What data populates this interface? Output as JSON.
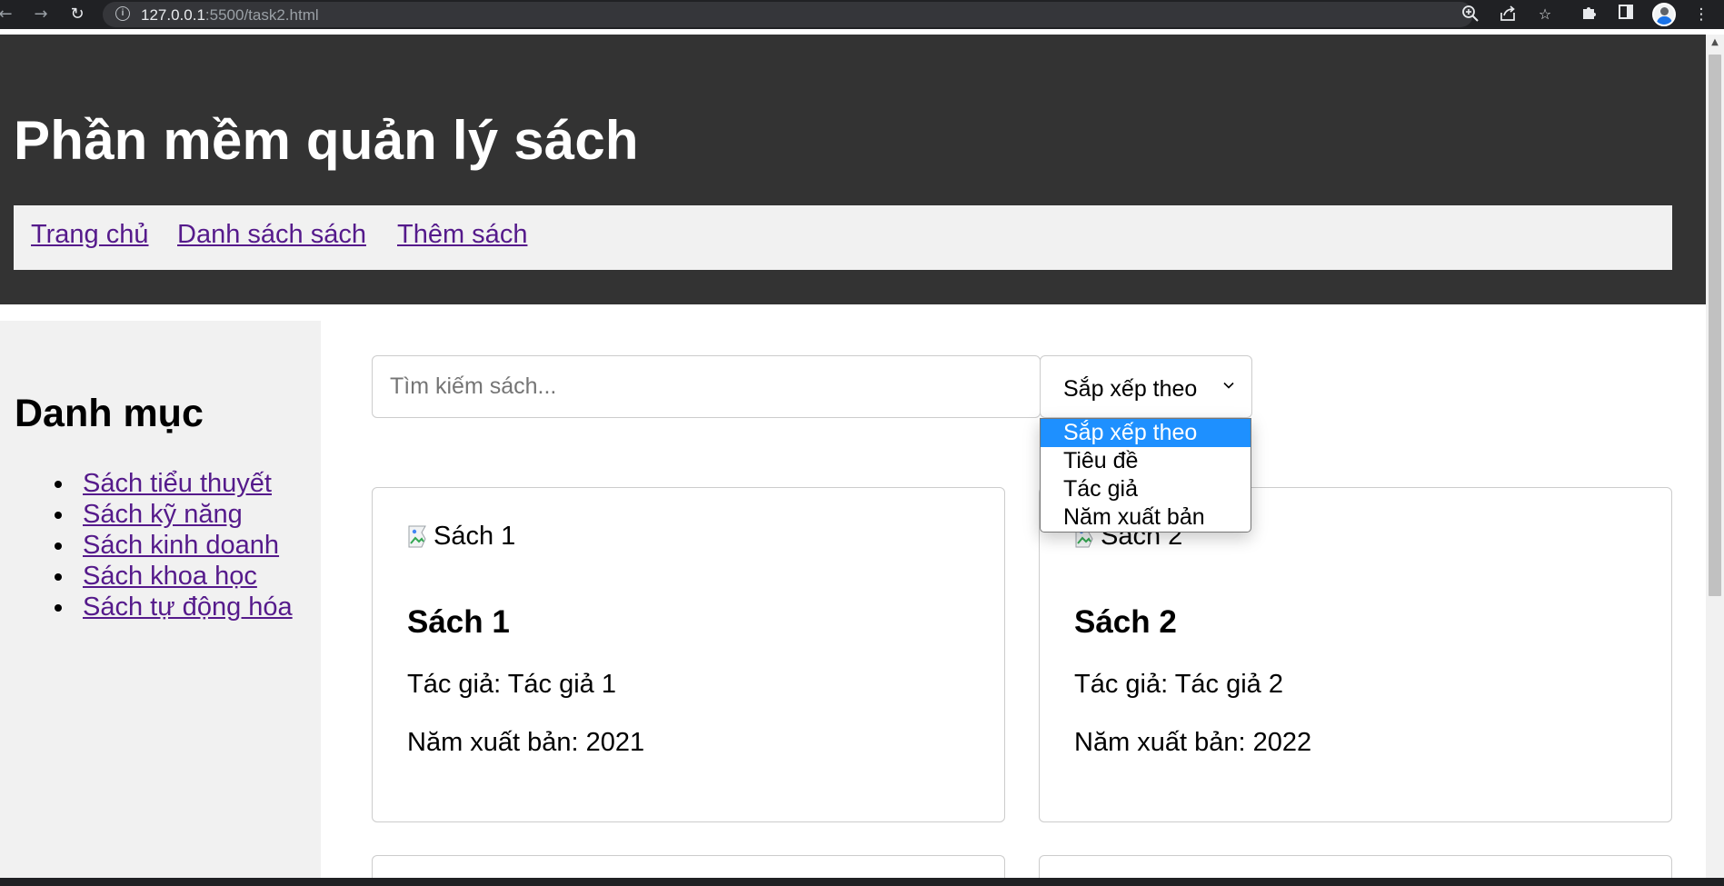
{
  "browser": {
    "url_host": "127.0.0.1",
    "url_rest": ":5500/task2.html",
    "icons": [
      "back-icon",
      "forward-icon",
      "reload-icon",
      "site-info-icon",
      "zoom-icon",
      "share-icon",
      "bookmark-star-icon",
      "extensions-icon",
      "side-panel-icon",
      "profile-avatar",
      "menu-icon"
    ]
  },
  "header": {
    "title": "Phần mềm quản lý sách",
    "nav": [
      "Trang chủ",
      "Danh sách sách",
      "Thêm sách"
    ]
  },
  "sidebar": {
    "title": "Danh mục",
    "items": [
      "Sách tiểu thuyết",
      "Sách kỹ năng",
      "Sách kinh doanh",
      "Sách khoa học",
      "Sách tự động hóa"
    ]
  },
  "search": {
    "placeholder": "Tìm kiếm sách..."
  },
  "sort": {
    "selected": "Sắp xếp theo",
    "options": [
      "Sắp xếp theo",
      "Tiêu đề",
      "Tác giả",
      "Năm xuất bản"
    ],
    "highlighted_index": 0
  },
  "books": [
    {
      "img_alt": "Sách 1",
      "title": "Sách 1",
      "author": "Tác giả: Tác giả 1",
      "year": "Năm xuất bản: 2021"
    },
    {
      "img_alt": "Sách 2",
      "title": "Sách 2",
      "author": "Tác giả: Tác giả 2",
      "year": "Năm xuất bản: 2022"
    }
  ],
  "colors": {
    "header_bg": "#333333",
    "nav_bg": "#f1f1f1",
    "link": "#551a8b",
    "option_highlight": "#1e90ff"
  }
}
